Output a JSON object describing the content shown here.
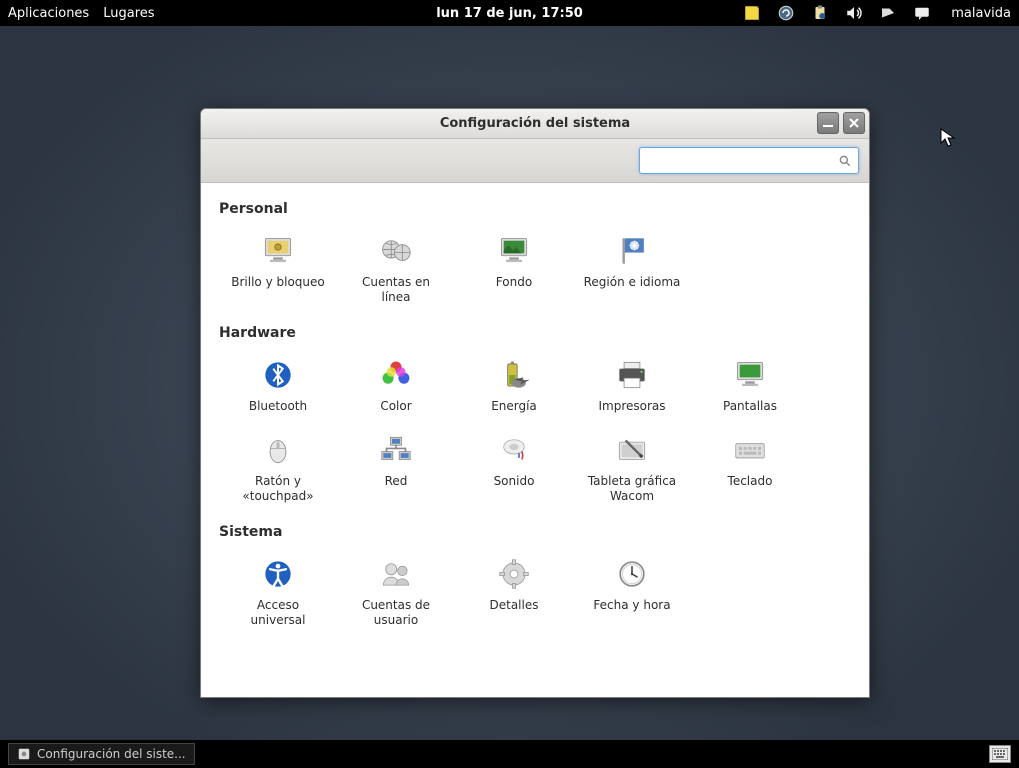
{
  "top_panel": {
    "apps": "Aplicaciones",
    "places": "Lugares",
    "clock": "lun 17 de jun, 17:50",
    "username": "malavida"
  },
  "window": {
    "title": "Configuración del sistema",
    "search_placeholder": ""
  },
  "sections": {
    "personal": "Personal",
    "hardware": "Hardware",
    "system": "Sistema"
  },
  "items": {
    "brillo": "Brillo y bloqueo",
    "cuentas_online": "Cuentas en línea",
    "fondo": "Fondo",
    "region": "Región e idioma",
    "bluetooth": "Bluetooth",
    "color": "Color",
    "energia": "Energía",
    "impresoras": "Impresoras",
    "pantallas": "Pantallas",
    "raton": "Ratón y «touchpad»",
    "red": "Red",
    "sonido": "Sonido",
    "wacom": "Tableta gráfica Wacom",
    "teclado": "Teclado",
    "acceso": "Acceso universal",
    "cuentas_usuario": "Cuentas de usuario",
    "detalles": "Detalles",
    "fecha": "Fecha y hora"
  },
  "taskbar": {
    "app": "Configuración del siste..."
  }
}
